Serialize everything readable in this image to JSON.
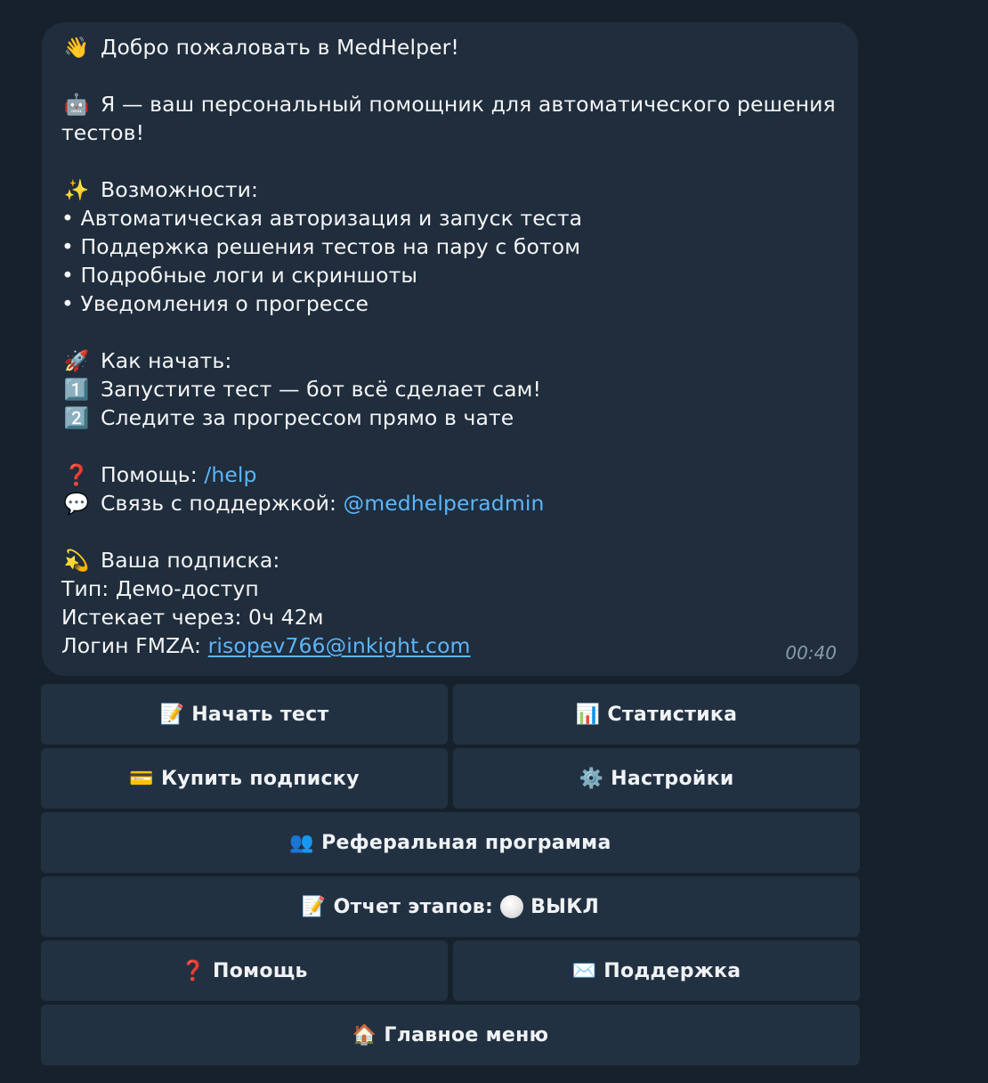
{
  "message": {
    "greeting_icon": "👋",
    "greeting": "Добро пожаловать в MedHelper!",
    "intro_icon": "🤖",
    "intro_line1": "Я — ваш персональный помощник для автоматического решения",
    "intro_line2": "тестов!",
    "features_icon": "✨",
    "features_title": "Возможности:",
    "features": [
      "• Автоматическая авторизация и запуск теста",
      "• Поддержка решения тестов на пару с ботом",
      "• Подробные логи и скриншоты",
      "• Уведомления о прогрессе"
    ],
    "start_icon": "🚀",
    "start_title": "Как начать:",
    "step1_icon": "1️⃣",
    "step1": "Запустите тест — бот всё сделает сам!",
    "step2_icon": "2️⃣",
    "step2": "Следите за прогрессом прямо в чате",
    "help_icon": "❓",
    "help_label": "Помощь: ",
    "help_link": "/help",
    "support_icon": "💬",
    "support_label": "Связь с поддержкой: ",
    "support_link": "@medhelperadmin",
    "sub_icon": "💫",
    "sub_title": "Ваша подписка:",
    "sub_type": "Тип: Демо-доступ",
    "sub_expires": "Истекает через: 0ч 42м",
    "login_label": "Логин FMZA: ",
    "login_value": "risopev766@inkight.com",
    "time": "00:40"
  },
  "keyboard": {
    "start_test": {
      "icon": "📝",
      "label": "Начать тест"
    },
    "stats": {
      "icon": "📊",
      "label": "Статистика"
    },
    "buy": {
      "icon": "💳",
      "label": "Купить подписку"
    },
    "settings": {
      "icon": "⚙️",
      "label": "Настройки"
    },
    "referral": {
      "icon": "👥",
      "label": "Реферальная программа"
    },
    "report": {
      "icon": "📝",
      "label": "Отчет этапов:",
      "state": "ВЫКЛ"
    },
    "help": {
      "icon": "❓",
      "label": "Помощь"
    },
    "support": {
      "icon": "✉️",
      "label": "Поддержка"
    },
    "main_menu": {
      "icon": "🏠",
      "label": "Главное меню"
    }
  },
  "colors": {
    "background": "#17212b",
    "bubble": "#1f2d3d",
    "button": "#223142",
    "link": "#5eb5f7"
  }
}
